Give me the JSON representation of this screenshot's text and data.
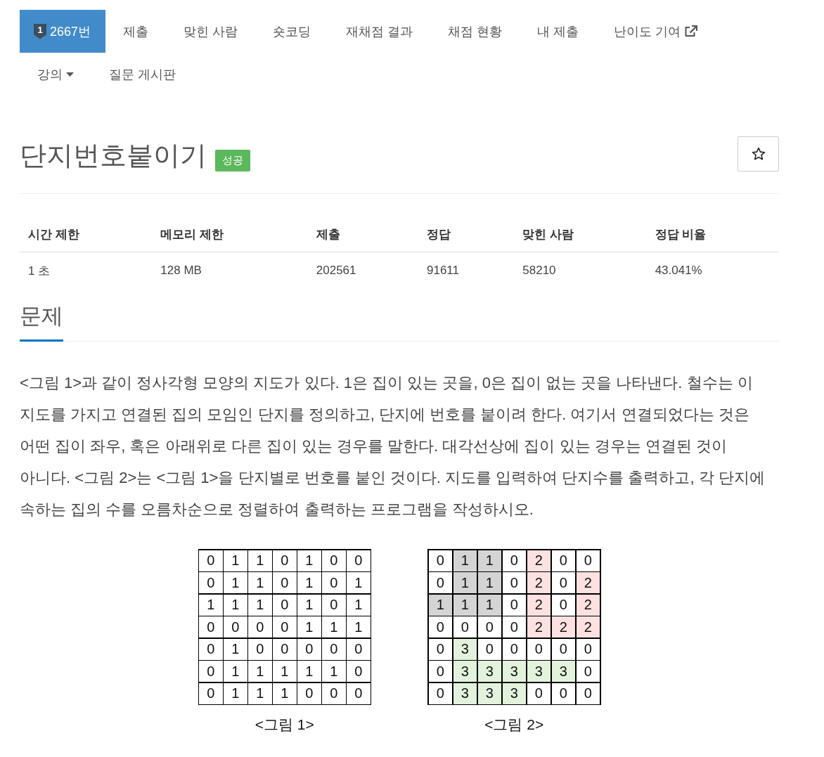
{
  "nav": {
    "items": [
      {
        "label": "2667번",
        "kind": "problem",
        "badge": "1",
        "selected": true
      },
      {
        "label": "제출",
        "kind": "link",
        "selected": false
      },
      {
        "label": "맞힌 사람",
        "kind": "link",
        "selected": false
      },
      {
        "label": "숏코딩",
        "kind": "link",
        "selected": false
      },
      {
        "label": "재채점 결과",
        "kind": "link",
        "selected": false
      },
      {
        "label": "채점 현황",
        "kind": "link",
        "selected": false
      },
      {
        "label": "내 제출",
        "kind": "link",
        "selected": false
      },
      {
        "label": "난이도 기여",
        "kind": "external",
        "selected": false
      },
      {
        "label": "강의",
        "kind": "dropdown",
        "selected": false
      },
      {
        "label": "질문 게시판",
        "kind": "link",
        "selected": false
      }
    ]
  },
  "problem": {
    "title": "단지번호붙이기",
    "status": "성공",
    "starred": false
  },
  "info_table": {
    "columns": [
      "시간 제한",
      "메모리 제한",
      "제출",
      "정답",
      "맞힌 사람",
      "정답 비율"
    ],
    "rows": [
      [
        "1 초",
        "128 MB",
        "202561",
        "91611",
        "58210",
        "43.041%"
      ]
    ]
  },
  "section": {
    "heading": "문제",
    "paragraph": "<그림 1>과 같이 정사각형 모양의 지도가 있다. 1은 집이 있는 곳을, 0은 집이 없는 곳을 나타낸다. 철수는 이 지도를 가지고 연결된 집의 모임인 단지를 정의하고, 단지에 번호를 붙이려 한다. 여기서 연결되었다는 것은 어떤 집이 좌우, 혹은 아래위로 다른 집이 있는 경우를 말한다. 대각선상에 집이 있는 경우는 연결된 것이 아니다. <그림 2>는 <그림 1>을 단지별로 번호를 붙인 것이다. 지도를 입력하여 단지수를 출력하고, 각 단지에 속하는 집의 수를 오름차순으로 정렬하여 출력하는 프로그램을 작성하시오.",
    "figures": [
      {
        "caption": "<그림 1>",
        "rows": [
          [
            {
              "text": "0"
            },
            {
              "text": "1"
            },
            {
              "text": "1"
            },
            {
              "text": "0"
            },
            {
              "text": "1"
            },
            {
              "text": "0"
            },
            {
              "text": "0"
            }
          ],
          [
            {
              "text": "0"
            },
            {
              "text": "1"
            },
            {
              "text": "1"
            },
            {
              "text": "0"
            },
            {
              "text": "1"
            },
            {
              "text": "0"
            },
            {
              "text": "1"
            }
          ],
          [
            {
              "text": "1"
            },
            {
              "text": "1"
            },
            {
              "text": "1"
            },
            {
              "text": "0"
            },
            {
              "text": "1"
            },
            {
              "text": "0"
            },
            {
              "text": "1"
            }
          ],
          [
            {
              "text": "0"
            },
            {
              "text": "0"
            },
            {
              "text": "0"
            },
            {
              "text": "0"
            },
            {
              "text": "1"
            },
            {
              "text": "1"
            },
            {
              "text": "1"
            }
          ],
          [
            {
              "text": "0"
            },
            {
              "text": "1"
            },
            {
              "text": "0"
            },
            {
              "text": "0"
            },
            {
              "text": "0"
            },
            {
              "text": "0"
            },
            {
              "text": "0"
            }
          ],
          [
            {
              "text": "0"
            },
            {
              "text": "1"
            },
            {
              "text": "1"
            },
            {
              "text": "1"
            },
            {
              "text": "1"
            },
            {
              "text": "1"
            },
            {
              "text": "0"
            }
          ],
          [
            {
              "text": "0"
            },
            {
              "text": "1"
            },
            {
              "text": "1"
            },
            {
              "text": "1"
            },
            {
              "text": "0"
            },
            {
              "text": "0"
            },
            {
              "text": "0"
            }
          ]
        ]
      },
      {
        "caption": "<그림 2>",
        "rows": [
          [
            {
              "text": "0"
            },
            {
              "text": "1",
              "color": "#d4d4d4"
            },
            {
              "text": "1",
              "color": "#d4d4d4"
            },
            {
              "text": "0"
            },
            {
              "text": "2",
              "color": "#fde0e0"
            },
            {
              "text": "0"
            },
            {
              "text": "0"
            }
          ],
          [
            {
              "text": "0"
            },
            {
              "text": "1",
              "color": "#d4d4d4"
            },
            {
              "text": "1",
              "color": "#d4d4d4"
            },
            {
              "text": "0"
            },
            {
              "text": "2",
              "color": "#fde0e0"
            },
            {
              "text": "0"
            },
            {
              "text": "2",
              "color": "#fde0e0"
            }
          ],
          [
            {
              "text": "1",
              "color": "#d4d4d4"
            },
            {
              "text": "1",
              "color": "#d4d4d4"
            },
            {
              "text": "1",
              "color": "#d4d4d4"
            },
            {
              "text": "0"
            },
            {
              "text": "2",
              "color": "#fde0e0"
            },
            {
              "text": "0"
            },
            {
              "text": "2",
              "color": "#fde0e0"
            }
          ],
          [
            {
              "text": "0"
            },
            {
              "text": "0"
            },
            {
              "text": "0"
            },
            {
              "text": "0"
            },
            {
              "text": "2",
              "color": "#fde0e0"
            },
            {
              "text": "2",
              "color": "#fde0e0"
            },
            {
              "text": "2",
              "color": "#fde0e0"
            }
          ],
          [
            {
              "text": "0"
            },
            {
              "text": "3",
              "color": "#e2f2dc"
            },
            {
              "text": "0"
            },
            {
              "text": "0"
            },
            {
              "text": "0"
            },
            {
              "text": "0"
            },
            {
              "text": "0"
            }
          ],
          [
            {
              "text": "0"
            },
            {
              "text": "3",
              "color": "#e2f2dc"
            },
            {
              "text": "3",
              "color": "#e2f2dc"
            },
            {
              "text": "3",
              "color": "#e2f2dc"
            },
            {
              "text": "3",
              "color": "#e2f2dc"
            },
            {
              "text": "3",
              "color": "#e2f2dc"
            },
            {
              "text": "0"
            }
          ],
          [
            {
              "text": "0"
            },
            {
              "text": "3",
              "color": "#e2f2dc"
            },
            {
              "text": "3",
              "color": "#e2f2dc"
            },
            {
              "text": "3",
              "color": "#e2f2dc"
            },
            {
              "text": "0"
            },
            {
              "text": "0"
            },
            {
              "text": "0"
            }
          ]
        ]
      }
    ]
  }
}
